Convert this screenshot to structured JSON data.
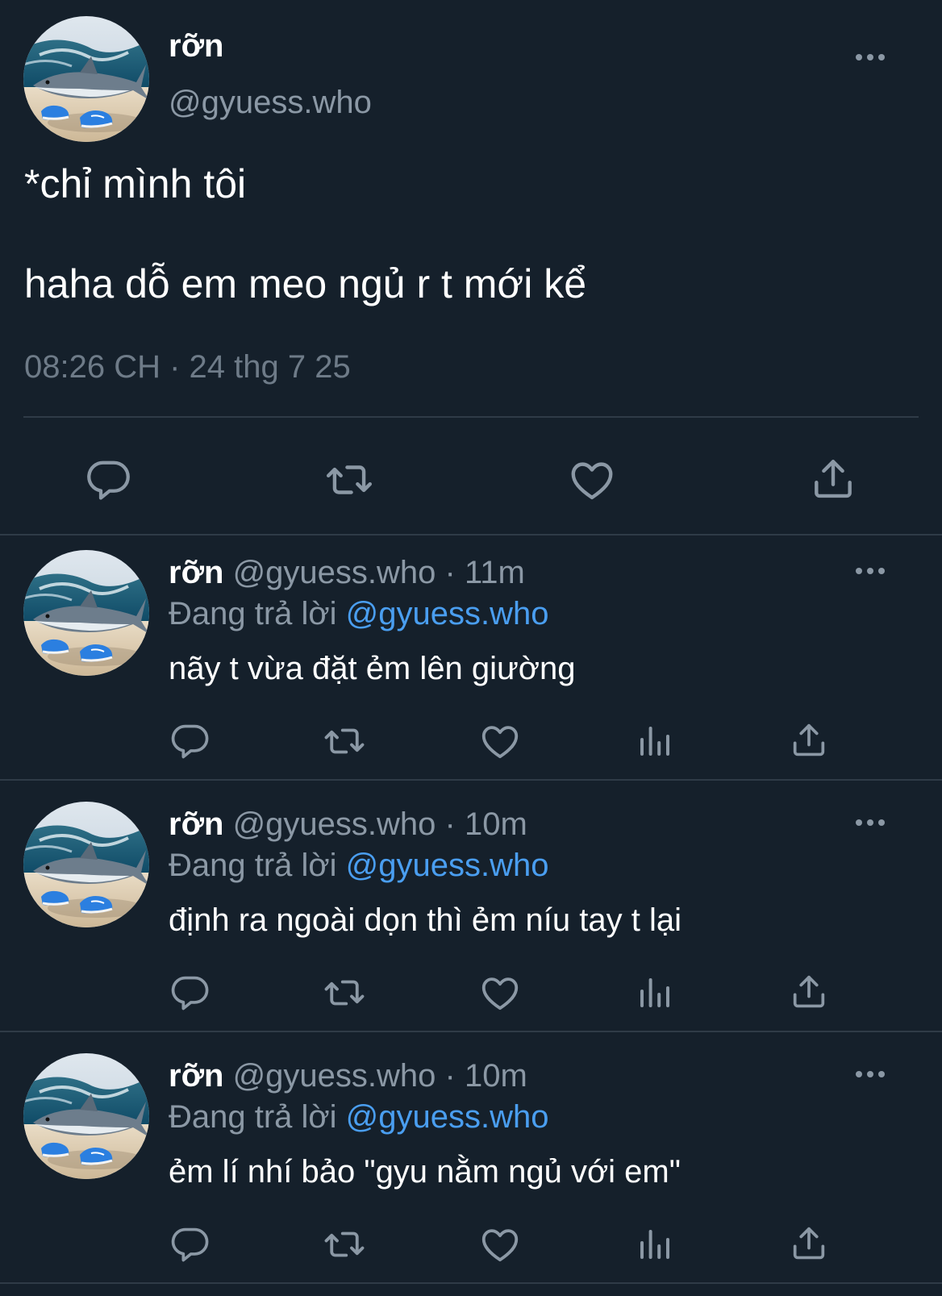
{
  "theme": {
    "background": "#15202b",
    "text": "#ffffff",
    "muted": "#8b98a5",
    "link": "#4a9ef0",
    "divider": "#2f3b47",
    "icon": "#8b98a5"
  },
  "main_tweet": {
    "author_name": "rỡn",
    "author_handle": "@gyuess.who",
    "text_line_1": "*chỉ mình tôi",
    "text_line_2": "haha dỗ em meo ngủ r t mới kể",
    "timestamp": "08:26 CH · 24 thg 7 25",
    "actions": [
      "reply-icon",
      "retweet-icon",
      "like-icon",
      "share-icon"
    ]
  },
  "replies": [
    {
      "name": "rỡn",
      "meta": "@gyuess.who · 11m",
      "replying_label": "Đang trả lời",
      "replying_to": "@gyuess.who",
      "text": "nãy t vừa đặt ẻm lên giường"
    },
    {
      "name": "rỡn",
      "meta": "@gyuess.who · 10m",
      "replying_label": "Đang trả lời",
      "replying_to": "@gyuess.who",
      "text": "định ra ngoài dọn thì ẻm níu tay t lại"
    },
    {
      "name": "rỡn",
      "meta": "@gyuess.who · 10m",
      "replying_label": "Đang trả lời",
      "replying_to": "@gyuess.who",
      "text": "ẻm lí nhí bảo \"gyu nằm ngủ với em\""
    }
  ],
  "reply_actions": [
    "reply-icon",
    "retweet-icon",
    "like-icon",
    "views-icon",
    "share-icon"
  ]
}
